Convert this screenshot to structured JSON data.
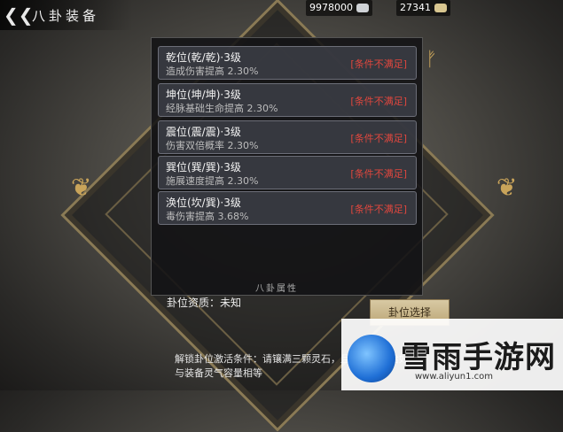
{
  "header": {
    "title": "八卦装备"
  },
  "currencies": [
    {
      "value": "9978000",
      "icon": "silver-ingot-icon"
    },
    {
      "value": "27341",
      "icon": "gold-ingot-icon"
    }
  ],
  "tooltip": {
    "rows": [
      {
        "name": "乾位(乾/乾)·3级",
        "desc": "造成伤害提高 2.30%",
        "cond": "[条件不满足]"
      },
      {
        "name": "坤位(坤/坤)·3级",
        "desc": "经脉基础生命提高 2.30%",
        "cond": "[条件不满足]"
      },
      {
        "name": "震位(震/震)·3级",
        "desc": "伤害双倍概率 2.30%",
        "cond": "[条件不满足]"
      },
      {
        "name": "巽位(巽/巽)·3级",
        "desc": "施展速度提高 2.30%",
        "cond": "[条件不满足]"
      },
      {
        "name": "涣位(坎/巽)·3级",
        "desc": "毒伤害提高 3.68%",
        "cond": "[条件不满足]"
      }
    ],
    "attr_label": "八卦属性",
    "quality": "卦位资质：未知"
  },
  "select_button": "卦位选择",
  "unlock_text": "解锁卦位激活条件：请镶满三颗灵石，且气值总和恰好与装备灵气容量相等",
  "watermark": {
    "text": "雪雨手游网",
    "url": "www.aliyun1.com"
  }
}
